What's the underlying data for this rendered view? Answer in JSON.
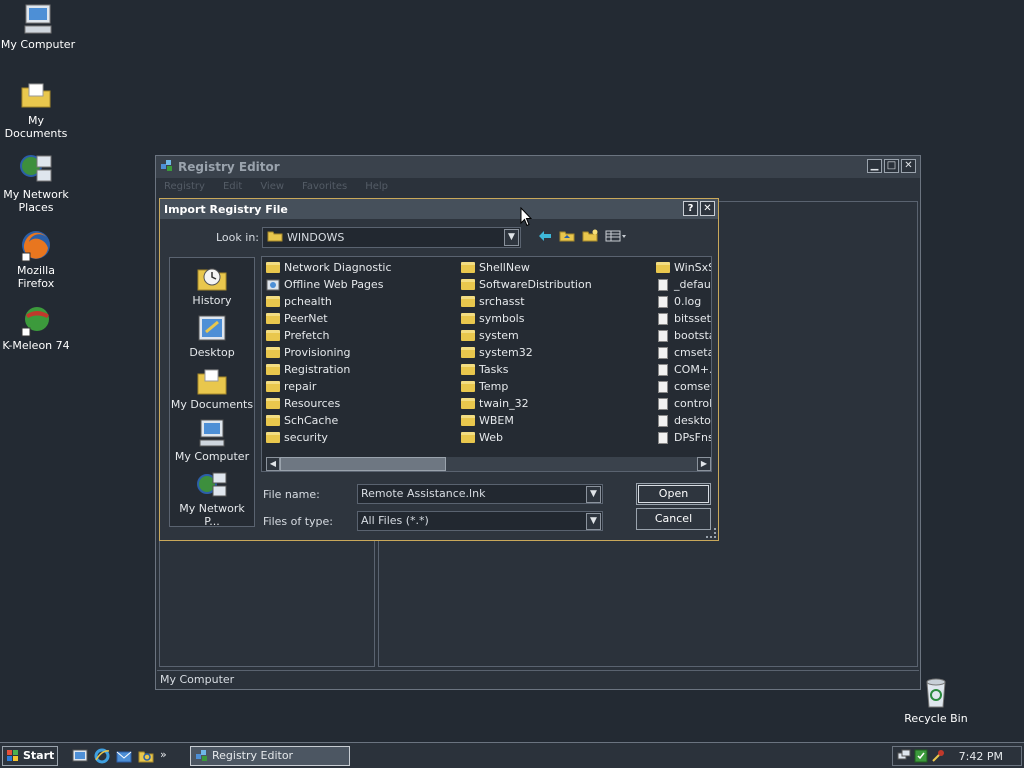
{
  "desktop": {
    "icons": [
      {
        "label": "My Computer"
      },
      {
        "label": "My Documents"
      },
      {
        "label": "My Network Places"
      },
      {
        "label": "Mozilla Firefox"
      },
      {
        "label": "K-Meleon 74"
      },
      {
        "label": "Recycle Bin"
      }
    ]
  },
  "registry_window": {
    "title": "Registry Editor",
    "menu": [
      "Registry",
      "Edit",
      "View",
      "Favorites",
      "Help"
    ],
    "status": "My Computer"
  },
  "dialog": {
    "title": "Import Registry File",
    "help_label": "?",
    "close_label": "✕",
    "look_in_label": "Look in:",
    "look_in_value": "WINDOWS",
    "places": [
      "History",
      "Desktop",
      "My Documents",
      "My Computer",
      "My Network P..."
    ],
    "columns": [
      [
        {
          "name": "Network Diagnostic",
          "type": "folder"
        },
        {
          "name": "Offline Web Pages",
          "type": "special"
        },
        {
          "name": "pchealth",
          "type": "folder"
        },
        {
          "name": "PeerNet",
          "type": "folder"
        },
        {
          "name": "Prefetch",
          "type": "folder"
        },
        {
          "name": "Provisioning",
          "type": "folder"
        },
        {
          "name": "Registration",
          "type": "folder"
        },
        {
          "name": "repair",
          "type": "folder"
        },
        {
          "name": "Resources",
          "type": "folder"
        },
        {
          "name": "SchCache",
          "type": "folder"
        },
        {
          "name": "security",
          "type": "folder"
        }
      ],
      [
        {
          "name": "ShellNew",
          "type": "folder"
        },
        {
          "name": "SoftwareDistribution",
          "type": "folder"
        },
        {
          "name": "srchasst",
          "type": "folder"
        },
        {
          "name": "symbols",
          "type": "folder"
        },
        {
          "name": "system",
          "type": "folder"
        },
        {
          "name": "system32",
          "type": "folder"
        },
        {
          "name": "Tasks",
          "type": "folder"
        },
        {
          "name": "Temp",
          "type": "folder"
        },
        {
          "name": "twain_32",
          "type": "folder"
        },
        {
          "name": "WBEM",
          "type": "folder"
        },
        {
          "name": "Web",
          "type": "folder"
        }
      ],
      [
        {
          "name": "WinSxS",
          "type": "folder"
        },
        {
          "name": "_defaul",
          "type": "doc"
        },
        {
          "name": "0.log",
          "type": "doc"
        },
        {
          "name": "bitsset",
          "type": "doc"
        },
        {
          "name": "bootsta",
          "type": "doc"
        },
        {
          "name": "cmsetac",
          "type": "doc"
        },
        {
          "name": "COM+.l",
          "type": "doc"
        },
        {
          "name": "comsetu",
          "type": "doc"
        },
        {
          "name": "control.",
          "type": "doc"
        },
        {
          "name": "desktop",
          "type": "doc"
        },
        {
          "name": "DPsFnsl",
          "type": "doc"
        }
      ]
    ],
    "file_name_label": "File name:",
    "file_name_value": "Remote Assistance.lnk",
    "files_of_type_label": "Files of type:",
    "files_of_type_value": "All Files (*.*)",
    "open_label": "Open",
    "cancel_label": "Cancel"
  },
  "taskbar": {
    "start_label": "Start",
    "task_label": "Registry Editor",
    "clock": "7:42 PM",
    "quicklaunch_more": "»"
  }
}
